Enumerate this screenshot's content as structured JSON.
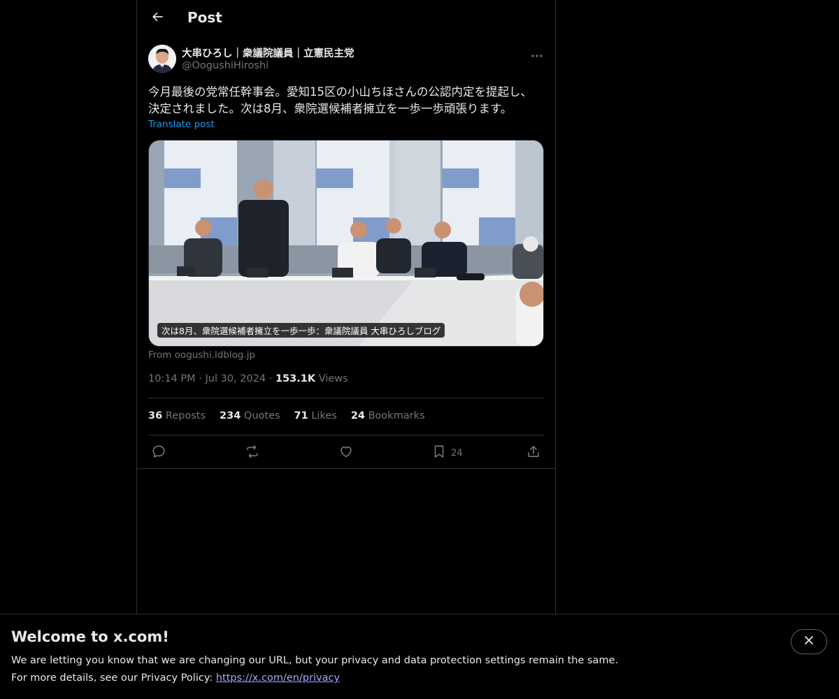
{
  "header": {
    "title": "Post",
    "back_icon": "arrow-left-icon"
  },
  "post": {
    "author_name": "大串ひろし｜衆議院議員｜立憲民主党",
    "author_handle": "@OogushiHiroshi",
    "more_icon": "more-horizontal-icon",
    "text_line1": "今月最後の党常任幹事会。愛知15区の小山ちほさんの公認内定を提起し、",
    "text_line2": "決定されました。次は8月、衆院選候補者擁立を一歩一歩頑張ります。",
    "translate_label": "Translate post",
    "card": {
      "caption": "次は8月、衆院選候補者擁立を一歩一歩：衆議院議員 大串ひろしブログ",
      "source": "From oogushi.ldblog.jp"
    },
    "time": "10:14 PM",
    "date": "Jul 30, 2024",
    "views_count": "153.1K",
    "views_label": "Views",
    "stats": [
      {
        "count": "36",
        "label": "Reposts"
      },
      {
        "count": "234",
        "label": "Quotes"
      },
      {
        "count": "71",
        "label": "Likes"
      },
      {
        "count": "24",
        "label": "Bookmarks"
      }
    ],
    "actions": {
      "bookmark_count": "24"
    }
  },
  "banner": {
    "title": "Welcome to x.com!",
    "line1": "We are letting you know that we are changing our URL, but your privacy and data protection settings remain the same.",
    "line2_prefix": "For more details, see our Privacy Policy: ",
    "link_text": "https://x.com/en/privacy"
  },
  "colors": {
    "background": "#000000",
    "text": "#e7e9ea",
    "secondary": "#71767b",
    "accent": "#1d9bf0",
    "border": "#2f3336"
  }
}
